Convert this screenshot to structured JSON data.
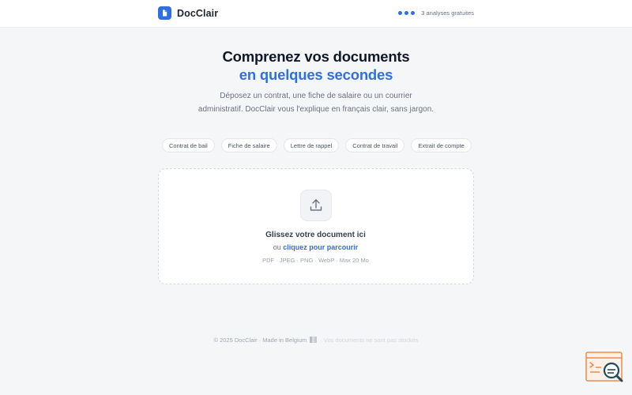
{
  "header": {
    "brand": "DocClair",
    "quota_text": "3 analyses gratuites"
  },
  "hero": {
    "title_line1": "Comprenez vos documents",
    "title_line2": "en quelques secondes",
    "subtitle": "Déposez un contrat, une fiche de salaire ou un courrier administratif. DocClair vous l'explique en français clair, sans jargon."
  },
  "chips": [
    "Contrat de bail",
    "Fiche de salaire",
    "Lettre de rappel",
    "Contrat de travail",
    "Extrait de compte"
  ],
  "dropzone": {
    "title": "Glissez votre document ici",
    "alt_prefix": "ou",
    "alt_link": "cliquez pour parcourir",
    "formats": "PDF · JPEG · PNG · WebP · Max 20 Mo"
  },
  "footer": {
    "left": "© 2025 DocClair · Made in Belgium",
    "right": "· Vos documents ne sont pas stockés"
  },
  "colors": {
    "accent": "#2f6fe4",
    "background": "#f5f6f8",
    "text": "#111827",
    "widget_orange": "#ee8a4a",
    "widget_teal": "#1f4e5a"
  },
  "icons": {
    "logo": "document-icon",
    "upload": "upload-icon",
    "widget": "search-assistant-icon"
  }
}
